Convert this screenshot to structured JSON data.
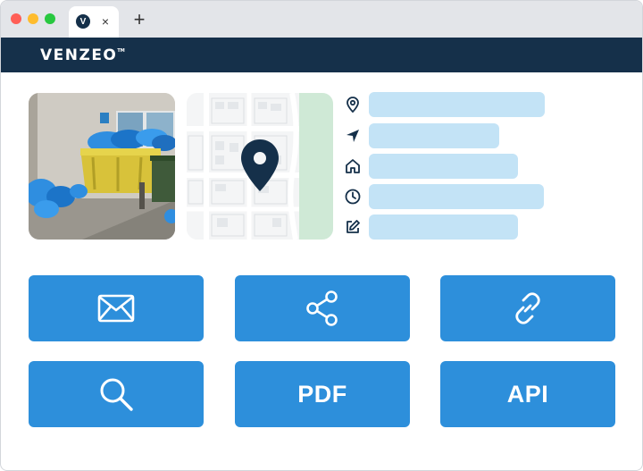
{
  "browser": {
    "tab_favicon_letter": "V",
    "tab_close_glyph": "×",
    "new_tab_glyph": "+",
    "traffic_lights": [
      "#ff5f57",
      "#febc2e",
      "#28c840"
    ]
  },
  "header": {
    "logo_text": "VENZEO",
    "logo_tm": "TM",
    "background": "#15304a"
  },
  "media": {
    "photo_icon": "photo-of-overflowing-trash-bins",
    "map_icon": "map-with-location-pin"
  },
  "info_rows": [
    {
      "icon": "location-pin-icon"
    },
    {
      "icon": "navigation-arrow-icon"
    },
    {
      "icon": "home-icon"
    },
    {
      "icon": "clock-icon"
    },
    {
      "icon": "edit-icon"
    }
  ],
  "actions": [
    {
      "icon": "envelope-icon",
      "label": ""
    },
    {
      "icon": "share-icon",
      "label": ""
    },
    {
      "icon": "link-icon",
      "label": ""
    },
    {
      "icon": "search-icon",
      "label": ""
    },
    {
      "icon": "",
      "label": "PDF"
    },
    {
      "icon": "",
      "label": "API"
    }
  ],
  "colors": {
    "accent": "#2d8fdb",
    "placeholder_bar": "#c3e3f6",
    "icon_dark": "#15304a"
  }
}
